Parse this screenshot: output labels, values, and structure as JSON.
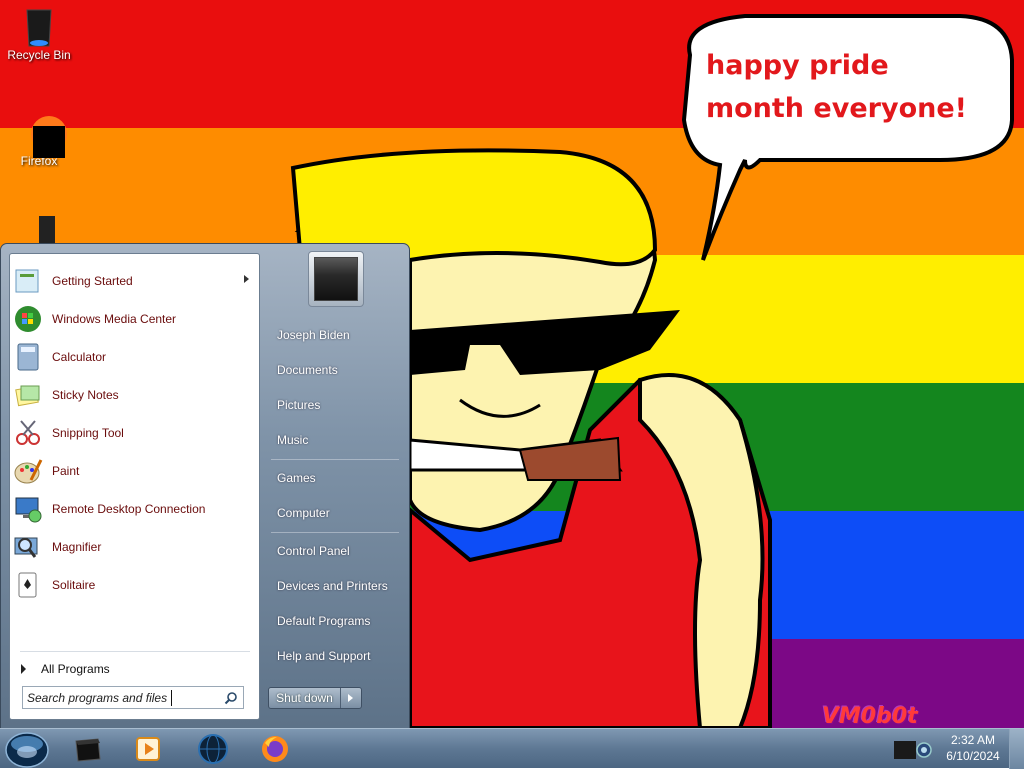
{
  "desktop": {
    "icons": [
      {
        "label": "Recycle Bin",
        "icon": "recycle-bin-icon"
      },
      {
        "label": "Firefox",
        "icon": "firefox-icon"
      }
    ],
    "wallpaper": {
      "speech_bubble_text": "happy pride month everyone!",
      "watermark": "VM0b0t",
      "band_colors": [
        "#e90e0e",
        "#fe8c00",
        "#ffee00",
        "#14861e",
        "#0d4df7",
        "#7c0886"
      ]
    }
  },
  "start_menu": {
    "programs": [
      {
        "label": "Getting Started",
        "icon": "getting-started-icon",
        "has_submenu": true
      },
      {
        "label": "Windows Media Center",
        "icon": "windows-media-center-icon"
      },
      {
        "label": "Calculator",
        "icon": "calculator-icon"
      },
      {
        "label": "Sticky Notes",
        "icon": "sticky-notes-icon"
      },
      {
        "label": "Snipping Tool",
        "icon": "snipping-tool-icon"
      },
      {
        "label": "Paint",
        "icon": "paint-icon"
      },
      {
        "label": "Remote Desktop Connection",
        "icon": "remote-desktop-icon"
      },
      {
        "label": "Magnifier",
        "icon": "magnifier-icon"
      },
      {
        "label": "Solitaire",
        "icon": "solitaire-icon"
      }
    ],
    "all_programs": "All Programs",
    "search": {
      "placeholder": "Search programs and files"
    },
    "user_name": "Joseph Biden",
    "right_items": [
      "Documents",
      "Pictures",
      "Music",
      "Games",
      "Computer",
      "Control Panel",
      "Devices and Printers",
      "Default Programs",
      "Help and Support"
    ],
    "shutdown_label": "Shut down"
  },
  "taskbar": {
    "pinned": [
      "terminal-icon",
      "media-player-icon",
      "globe-icon",
      "firefox-icon"
    ],
    "tray_icon": "network-camera-icon",
    "time": "2:32 AM",
    "date": "6/10/2024"
  }
}
